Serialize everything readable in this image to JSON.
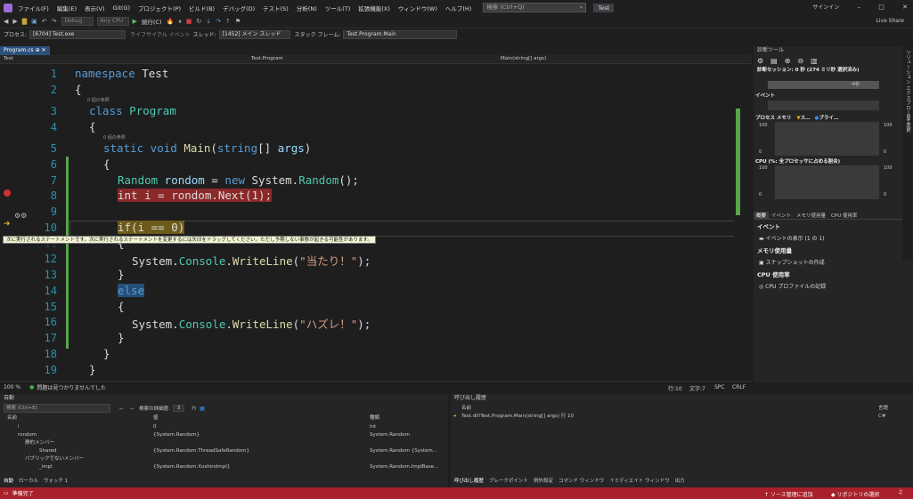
{
  "app": {
    "title": "Test",
    "menu": [
      "ファイル(F)",
      "編集(E)",
      "表示(V)",
      "Git(G)",
      "プロジェクト(P)",
      "ビルド(B)",
      "デバッグ(D)",
      "テスト(S)",
      "分析(N)",
      "ツール(T)",
      "拡張機能(X)",
      "ウィンドウ(W)",
      "ヘルプ(H)"
    ],
    "search_placeholder": "検索 (Ctrl+Q)",
    "signin": "サインイン",
    "live_share": "Live Share",
    "window_controls": [
      "–",
      "□",
      "✕"
    ]
  },
  "toolbar": {
    "config": "Debug",
    "platform": "Any CPU",
    "continue": "続行(C)"
  },
  "debug_toolbar": {
    "process_label": "プロセス:",
    "process": "[6704] Test.exe",
    "lifecycle": "ライフサイクル イベント",
    "thread_label": "スレッド:",
    "thread": "[1452] メイン スレッド",
    "stack_label": "スタック フレーム:",
    "stack": "Test.Program.Main"
  },
  "tabs": {
    "active": "Program.cs",
    "nav": [
      "Test",
      "Test.Program",
      "Main(string[] args)"
    ]
  },
  "editor": {
    "line_numbers": [
      "1",
      "2",
      "3",
      "4",
      "5",
      "6",
      "7",
      "8",
      "9",
      "10",
      "11",
      "12",
      "13",
      "14",
      "15",
      "16",
      "17",
      "18",
      "19"
    ],
    "refs0": "0 個の参照",
    "tooltip": "次に実行されるステートメントです。次に実行されるステートメントを変更するには矢印をドラッグしてください。ただし予期しない事態が起きる可能性があります。",
    "code": {
      "l1_kw": "namespace",
      "l1_id": " Test",
      "brace_open": "{",
      "brace_close": "}",
      "l3_kw": "class",
      "l3_ty": " Program",
      "l5_a": "static",
      "l5_b": " void ",
      "l5_fn": "Main",
      "l5_c": "(",
      "l5_d": "string",
      "l5_e": "[] ",
      "l5_f": "args",
      "l5_g": ")",
      "l7_ty": "Random",
      "l7_var": " rondom",
      "l7_eq": " = ",
      "l7_new": "new",
      "l7_sys": " System.",
      "l7_ty2": "Random",
      "l7_end": "();",
      "l8_kw": "int",
      "l8_rest": " i = rondom.Next(1);",
      "l10": "if(i == 0)",
      "sys": "System.",
      "console": "Console",
      "dot": ".",
      "writeline": "WriteLine",
      "paren_open": "(",
      "paren_close": ");",
      "str1": "\"当たり！\"",
      "str2": "\"ハズレ！\"",
      "l14": "else"
    }
  },
  "editor_status": {
    "zoom": "100 %",
    "issues": "問題は見つかりませんでした",
    "line": "行:10",
    "col": "文字:7",
    "spc": "SPC",
    "crlf": "CRLF"
  },
  "diag": {
    "title": "診断ツール",
    "session": "診断セッション: 0 秒 (274 ミリ秒 選択済み)",
    "ticks": "-4秒",
    "events": "イベント",
    "memory_label": "プロセス メモリ",
    "memory_legend": [
      "ス…",
      "プライ…"
    ],
    "cpu_label": "CPU (%: 全プロセッサに占める割合)",
    "axis_100": "100",
    "axis_0": "0",
    "tabs": [
      "概要",
      "イベント",
      "メモリ使用量",
      "CPU 使用率"
    ],
    "h_events": "イベント",
    "l_events": "イベントの表示 (1 の 1)",
    "h_memory": "メモリ使用量",
    "l_snapshot": "スナップショットの作成",
    "h_cpu": "CPU 使用率",
    "l_cpu": "CPU プロファイルの記録"
  },
  "sidebar_vertical": [
    "ソリューション エクスプローラー",
    "Git 変更"
  ],
  "autos": {
    "title": "自動",
    "search": "検索 (Ctrl+E)",
    "depth_label": "検索の詳細度:",
    "depth": "3",
    "headers": [
      "名前",
      "値",
      "種類"
    ],
    "rows": [
      {
        "name": "i",
        "value": "0",
        "type": "int"
      },
      {
        "name": "rondom",
        "value": "{System.Random}",
        "type": "System.Random"
      },
      {
        "name": "静的メンバー",
        "value": "",
        "type": ""
      },
      {
        "name": "Shared",
        "value": "{System.Random.ThreadSafeRandom}",
        "type": "System.Random {System..."
      },
      {
        "name": "パブリックでないメンバー",
        "value": "",
        "type": ""
      },
      {
        "name": "_impl",
        "value": "{System.Random.XoshiroImpl}",
        "type": "System.Random.ImplBase..."
      }
    ],
    "tabs": [
      "自動",
      "ローカル",
      "ウォッチ 1"
    ]
  },
  "callstack": {
    "title": "呼び出し履歴",
    "headers": [
      "名前",
      "言語"
    ],
    "rows": [
      {
        "name": "Test.dll!Test.Program.Main(string[] args) 行 10",
        "lang": "C#"
      }
    ],
    "tabs": [
      "呼び出し履歴",
      "ブレークポイント",
      "例外設定",
      "コマンド ウィンドウ",
      "イミディエイト ウィンドウ",
      "出力"
    ]
  },
  "status": {
    "ready": "準備完了",
    "source_control": "ソース管理に追加",
    "repo": "リポジトリの選択"
  },
  "colors": {
    "statusbar": "#a7202a",
    "accent": "#2d4f7c",
    "breakpoint": "#c33"
  }
}
